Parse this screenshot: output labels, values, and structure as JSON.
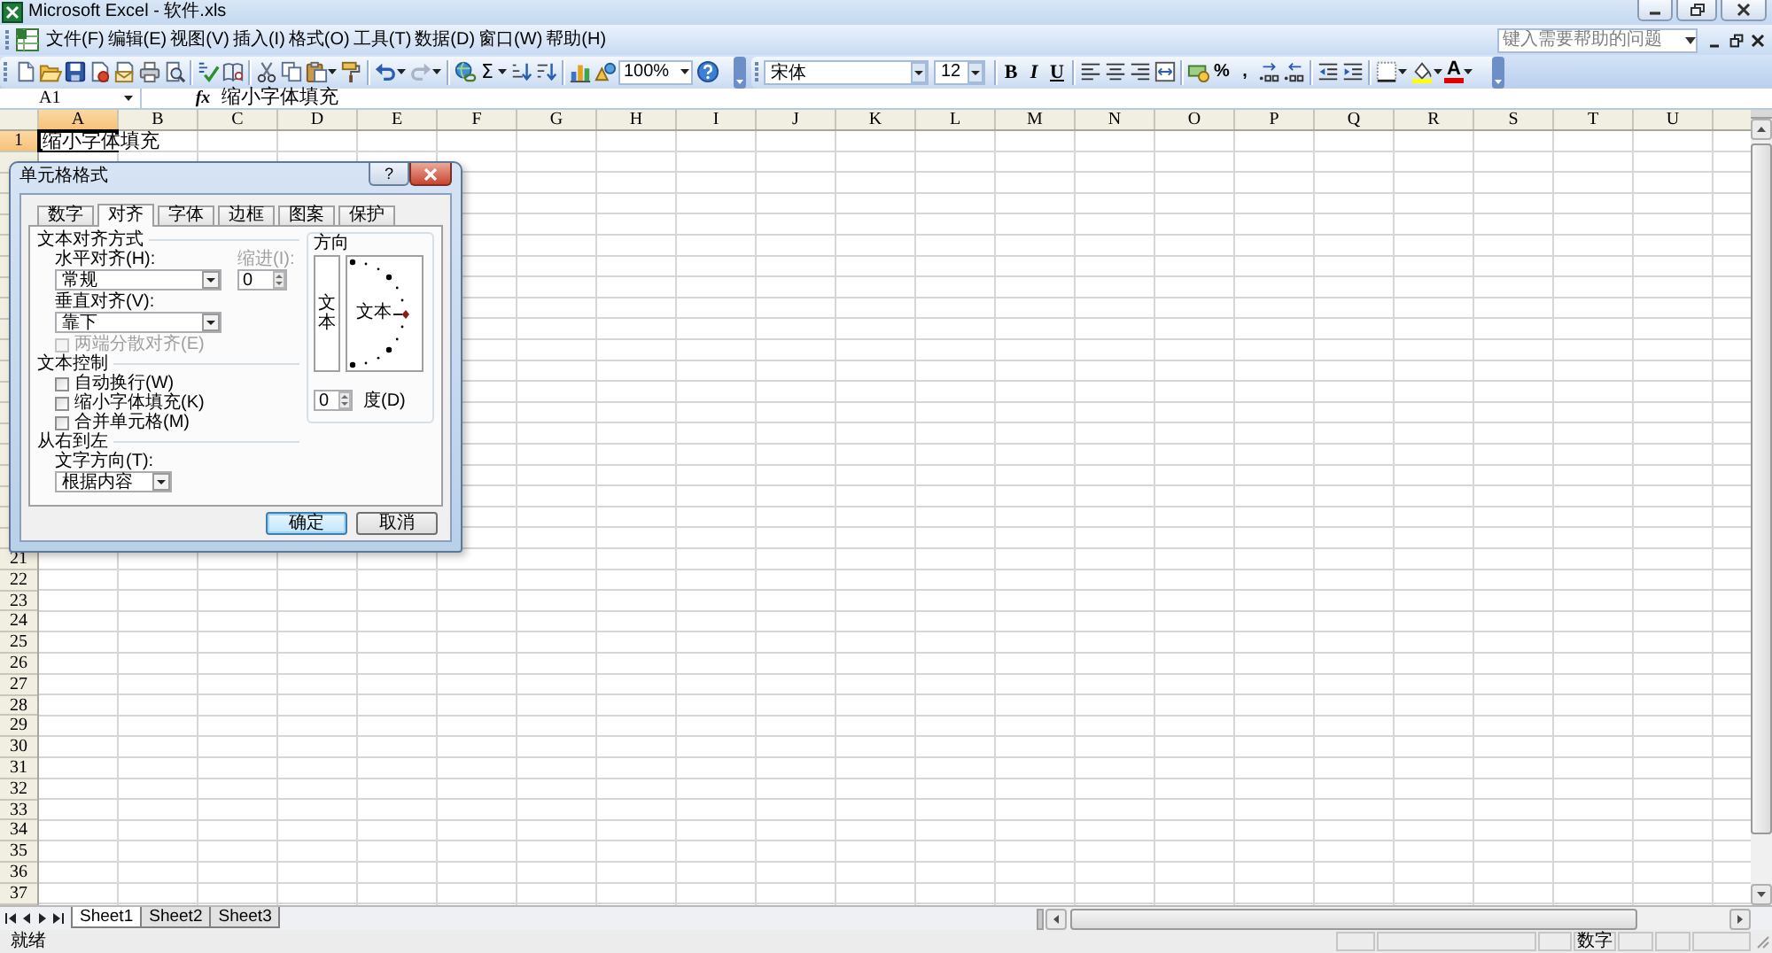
{
  "window": {
    "title": "Microsoft Excel - 软件.xls"
  },
  "menu_bar": {
    "items": [
      "文件(F)",
      "编辑(E)",
      "视图(V)",
      "插入(I)",
      "格式(O)",
      "工具(T)",
      "数据(D)",
      "窗口(W)",
      "帮助(H)"
    ],
    "help_search": {
      "placeholder": "键入需要帮助的问题"
    }
  },
  "standard_toolbar": {
    "autosum": "Σ",
    "zoom": "100%"
  },
  "formatting_toolbar": {
    "font": "宋体",
    "font_size": "12",
    "style_buttons": [
      "B",
      "I",
      "U"
    ],
    "percent": "%",
    "comma": ",",
    "font_color": "A"
  },
  "formula_bar": {
    "name_box": "A1",
    "function_label": "fx",
    "content": "缩小字体填充"
  },
  "sheet": {
    "columns": [
      {
        "label": "A",
        "selected": true
      },
      {
        "label": "B",
        "selected": false
      },
      {
        "label": "C",
        "selected": false
      },
      {
        "label": "D",
        "selected": false
      },
      {
        "label": "E",
        "selected": false
      },
      {
        "label": "F",
        "selected": false
      },
      {
        "label": "G",
        "selected": false
      },
      {
        "label": "H",
        "selected": false
      },
      {
        "label": "I",
        "selected": false
      },
      {
        "label": "J",
        "selected": false
      },
      {
        "label": "K",
        "selected": false
      },
      {
        "label": "L",
        "selected": false
      },
      {
        "label": "M",
        "selected": false
      },
      {
        "label": "N",
        "selected": false
      },
      {
        "label": "O",
        "selected": false
      },
      {
        "label": "P",
        "selected": false
      },
      {
        "label": "Q",
        "selected": false
      },
      {
        "label": "R",
        "selected": false
      },
      {
        "label": "S",
        "selected": false
      },
      {
        "label": "T",
        "selected": false
      },
      {
        "label": "U",
        "selected": false
      }
    ],
    "rows": [
      {
        "label": "1",
        "selected": true
      },
      {
        "label": "21",
        "selected": false
      },
      {
        "label": "22",
        "selected": false
      },
      {
        "label": "23",
        "selected": false
      },
      {
        "label": "24",
        "selected": false
      },
      {
        "label": "25",
        "selected": false
      },
      {
        "label": "26",
        "selected": false
      },
      {
        "label": "27",
        "selected": false
      },
      {
        "label": "28",
        "selected": false
      },
      {
        "label": "29",
        "selected": false
      },
      {
        "label": "30",
        "selected": false
      },
      {
        "label": "31",
        "selected": false
      },
      {
        "label": "32",
        "selected": false
      },
      {
        "label": "33",
        "selected": false
      },
      {
        "label": "34",
        "selected": false
      },
      {
        "label": "35",
        "selected": false
      },
      {
        "label": "36",
        "selected": false
      },
      {
        "label": "37",
        "selected": false
      }
    ],
    "active_cell": {
      "text": "缩小字体填充"
    }
  },
  "dialog": {
    "title": "单元格格式",
    "help_button": "?",
    "tabs": [
      {
        "label": "数字",
        "selected": false
      },
      {
        "label": "对齐",
        "selected": true
      },
      {
        "label": "字体",
        "selected": false
      },
      {
        "label": "边框",
        "selected": false
      },
      {
        "label": "图案",
        "selected": false
      },
      {
        "label": "保护",
        "selected": false
      }
    ],
    "text_alignment": {
      "title": "文本对齐方式",
      "horizontal": {
        "label": "水平对齐(H):",
        "value": "常规"
      },
      "indent": {
        "label": "缩进(I):",
        "value": "0",
        "disabled": true
      },
      "vertical": {
        "label": "垂直对齐(V):",
        "value": "靠下"
      },
      "justify_distributed": {
        "label": "两端分散对齐(E)",
        "checked": false,
        "disabled": true
      }
    },
    "text_control": {
      "title": "文本控制",
      "options": [
        {
          "label": "自动换行(W)",
          "checked": false
        },
        {
          "label": "缩小字体填充(K)",
          "checked": false
        },
        {
          "label": "合并单元格(M)",
          "checked": false
        }
      ]
    },
    "right_to_left": {
      "title": "从右到左",
      "direction": {
        "label": "文字方向(T):",
        "value": "根据内容"
      }
    },
    "orientation": {
      "title": "方向",
      "vertical_text": "文本",
      "dial_text": "文本",
      "degrees": {
        "value": "0",
        "label": "度(D)"
      }
    },
    "buttons": [
      {
        "label": "确定",
        "default": true
      },
      {
        "label": "取消",
        "default": false
      }
    ]
  },
  "sheet_tabs": [
    {
      "label": "Sheet1",
      "selected": true
    },
    {
      "label": "Sheet2",
      "selected": false
    },
    {
      "label": "Sheet3",
      "selected": false
    }
  ],
  "status_bar": {
    "mode": "就绪",
    "indicators": [
      "数字"
    ]
  }
}
